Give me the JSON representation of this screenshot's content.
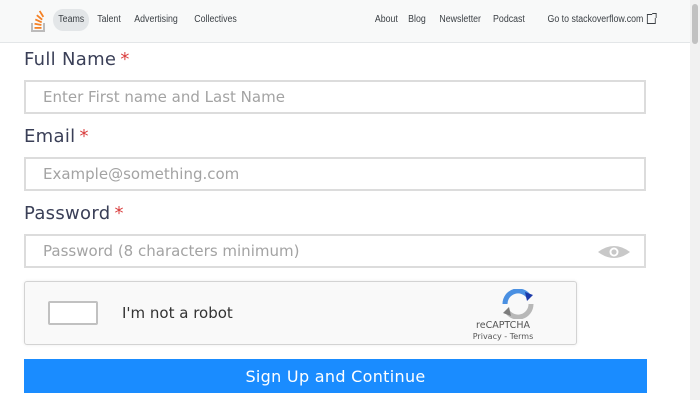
{
  "nav": {
    "left": [
      "Teams",
      "Talent",
      "Advertising",
      "Collectives"
    ],
    "right": [
      "About",
      "Blog",
      "Newsletter",
      "Podcast",
      "Go to stackoverflow.com"
    ]
  },
  "form": {
    "full_name_label": "Full Name",
    "full_name_placeholder": "Enter First name and Last Name",
    "email_label": "Email",
    "email_placeholder": "Example@something.com",
    "password_label": "Password",
    "password_placeholder": "Password (8 characters minimum)",
    "required_mark": "*",
    "submit_label": "Sign Up and Continue"
  },
  "captcha": {
    "label": "I'm not a robot",
    "brand": "reCAPTCHA",
    "links": "Privacy - Terms"
  },
  "colors": {
    "accent": "#1a8cff",
    "required": "#d93d3d",
    "label": "#3a3f57"
  }
}
